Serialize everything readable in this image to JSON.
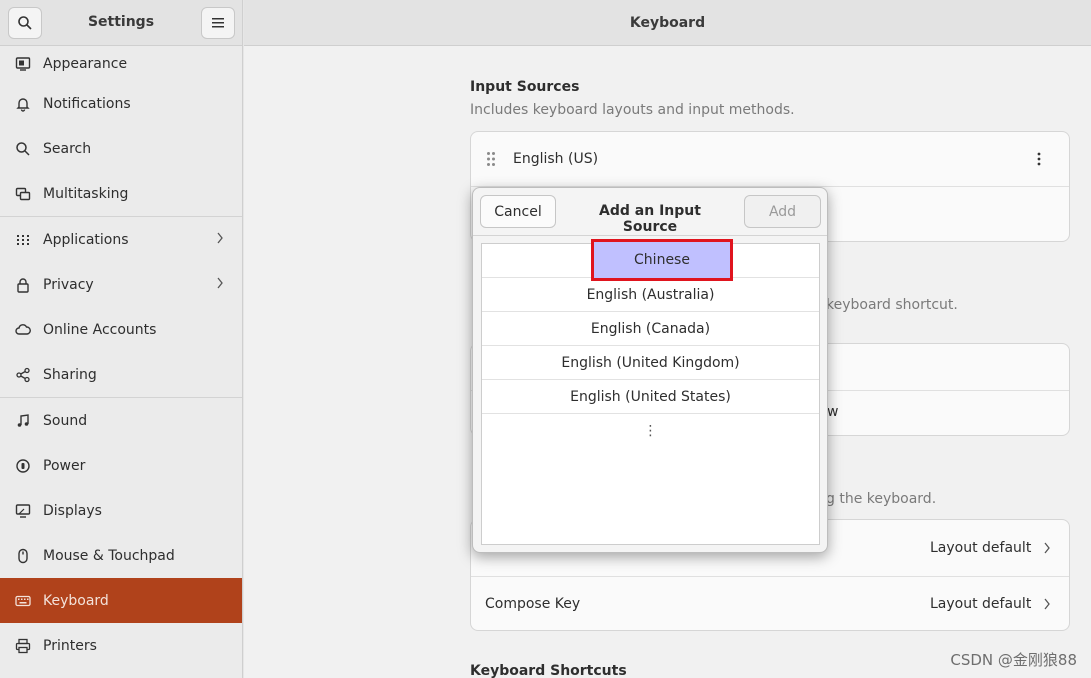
{
  "sidebar": {
    "title": "Settings",
    "search_icon": "search-icon",
    "menu_icon": "hamburger-menu-icon",
    "items": [
      {
        "label": "Appearance",
        "icon": "appearance-icon"
      },
      {
        "label": "Notifications",
        "icon": "bell-icon"
      },
      {
        "label": "Search",
        "icon": "search-icon"
      },
      {
        "label": "Multitasking",
        "icon": "multitasking-icon"
      },
      {
        "label": "Applications",
        "icon": "apps-grid-icon",
        "chevron": true
      },
      {
        "label": "Privacy",
        "icon": "lock-icon",
        "chevron": true
      },
      {
        "label": "Online Accounts",
        "icon": "cloud-icon"
      },
      {
        "label": "Sharing",
        "icon": "share-icon"
      },
      {
        "label": "Sound",
        "icon": "music-note-icon"
      },
      {
        "label": "Power",
        "icon": "power-icon"
      },
      {
        "label": "Displays",
        "icon": "display-icon"
      },
      {
        "label": "Mouse & Touchpad",
        "icon": "mouse-icon"
      },
      {
        "label": "Keyboard",
        "icon": "keyboard-icon",
        "active": true
      },
      {
        "label": "Printers",
        "icon": "printer-icon"
      }
    ]
  },
  "content": {
    "title": "Keyboard",
    "input_sources": {
      "title": "Input Sources",
      "subtitle": "Includes keyboard layouts and input methods.",
      "first_source": "English (US)"
    },
    "partial_texts": {
      "shortcut_hint": "keyboard shortcut.",
      "window_frag": "w",
      "keyboard_hint": "g the keyboard."
    },
    "special_rows": [
      {
        "label": "",
        "value": "Layout default"
      },
      {
        "label": "Compose Key",
        "value": "Layout default"
      }
    ],
    "shortcuts_title": "Keyboard Shortcuts"
  },
  "dialog": {
    "title": "Add an Input Source",
    "cancel_label": "Cancel",
    "add_label": "Add",
    "languages": [
      "Chinese",
      "English (Australia)",
      "English (Canada)",
      "English (United Kingdom)",
      "English (United States)"
    ],
    "more_glyph": "⋮",
    "highlight_color": "#e0141e",
    "selection_fill": "#c0c0ff"
  },
  "watermark": "CSDN @金刚狼88",
  "colors": {
    "accent": "#b0421b"
  }
}
